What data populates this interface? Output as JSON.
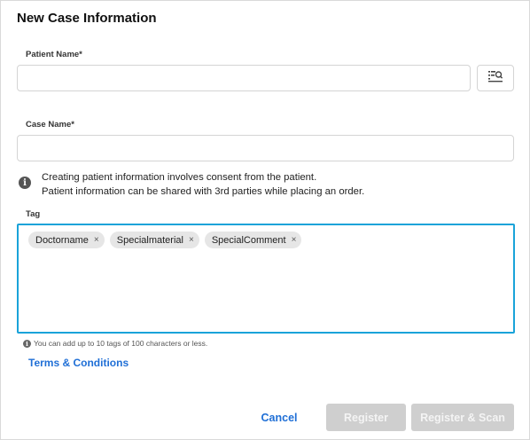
{
  "dialog": {
    "title": "New Case Information"
  },
  "patient_name": {
    "label": "Patient Name*",
    "value": "",
    "placeholder": ""
  },
  "case_name": {
    "label": "Case Name*",
    "value": "",
    "placeholder": ""
  },
  "notice": {
    "line1": "Creating patient information involves consent from the patient.",
    "line2": "Patient information can be shared with 3rd parties while placing an order."
  },
  "tag": {
    "label": "Tag",
    "chips": [
      "Doctorname",
      "Specialmaterial",
      "SpecialComment"
    ],
    "remove_symbol": "×",
    "hint": "You can add up to 10 tags of 100 characters or less."
  },
  "terms_link": "Terms & Conditions",
  "actions": {
    "cancel": "Cancel",
    "register": "Register",
    "register_scan": "Register & Scan"
  },
  "colors": {
    "accent": "#1f6fd6",
    "focus_border": "#1aa3d9",
    "disabled_button": "#cfcfcf"
  },
  "icons": {
    "patient_search": "list-search-icon",
    "notice": "info-icon",
    "hint": "info-icon"
  }
}
